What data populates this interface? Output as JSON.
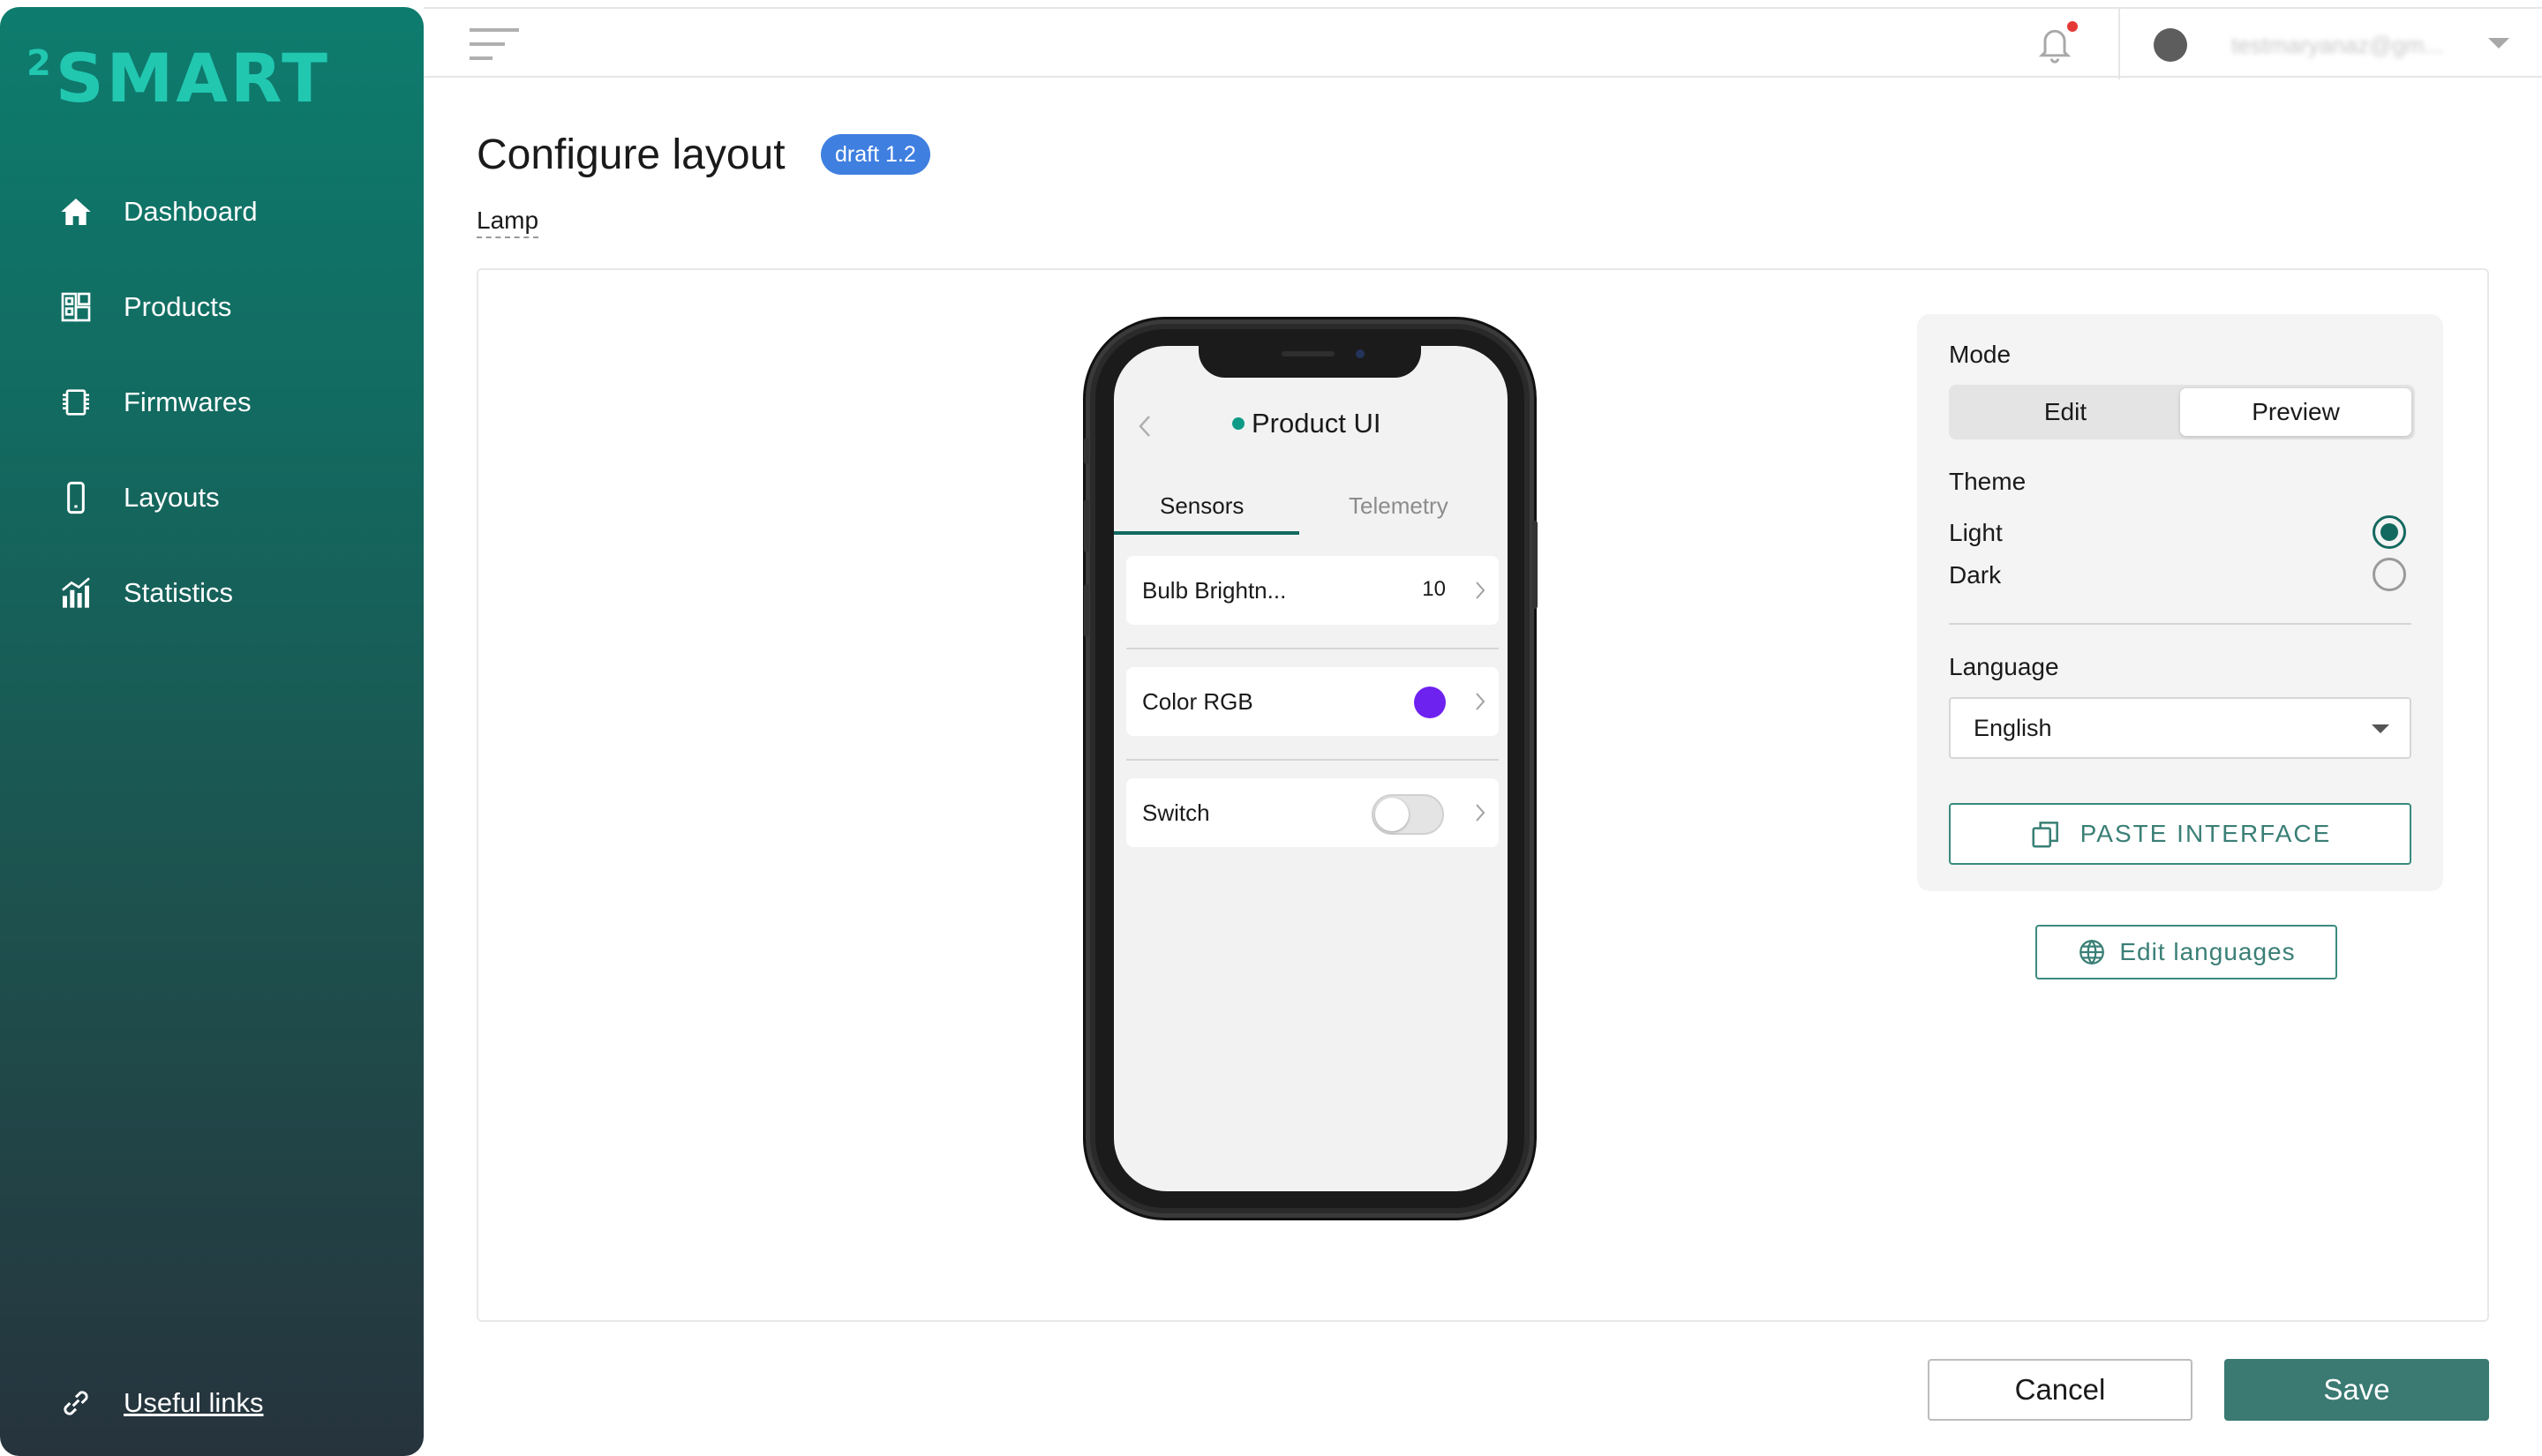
{
  "brand": {
    "logo_sup": "2",
    "logo_text": "SMART"
  },
  "sidebar": {
    "items": [
      {
        "label": "Dashboard",
        "icon": "home-icon"
      },
      {
        "label": "Products",
        "icon": "products-icon"
      },
      {
        "label": "Firmwares",
        "icon": "firmware-chip-icon"
      },
      {
        "label": "Layouts",
        "icon": "phone-icon"
      },
      {
        "label": "Statistics",
        "icon": "statistics-icon"
      }
    ],
    "useful_links": "Useful links"
  },
  "topbar": {
    "user_email": "testmaryanaz@gm..."
  },
  "page": {
    "title": "Configure layout",
    "badge": "draft 1.2",
    "subtitle": "Lamp"
  },
  "phone_app": {
    "title": "Product UI",
    "tabs": [
      "Sensors",
      "Telemetry"
    ],
    "active_tab": "Sensors",
    "rows": [
      {
        "label": "Bulb Brightn...",
        "value": "10"
      },
      {
        "label": "Color RGB",
        "color": "#6e22f0"
      },
      {
        "label": "Switch",
        "toggle": false
      }
    ]
  },
  "panel": {
    "mode_label": "Mode",
    "mode_options": [
      "Edit",
      "Preview"
    ],
    "mode_selected": "Preview",
    "theme_label": "Theme",
    "theme_options": [
      "Light",
      "Dark"
    ],
    "theme_selected": "Light",
    "language_label": "Language",
    "language_value": "English",
    "paste_button": "PASTE INTERFACE",
    "edit_languages_button": "Edit languages"
  },
  "footer": {
    "cancel": "Cancel",
    "save": "Save"
  },
  "colors": {
    "accent": "#13695f",
    "logo": "#22c7b0",
    "badge": "#3f7fe0",
    "save_button": "#3a7a72",
    "status_dot": "#0f9a87",
    "notification_dot": "#e53935"
  }
}
